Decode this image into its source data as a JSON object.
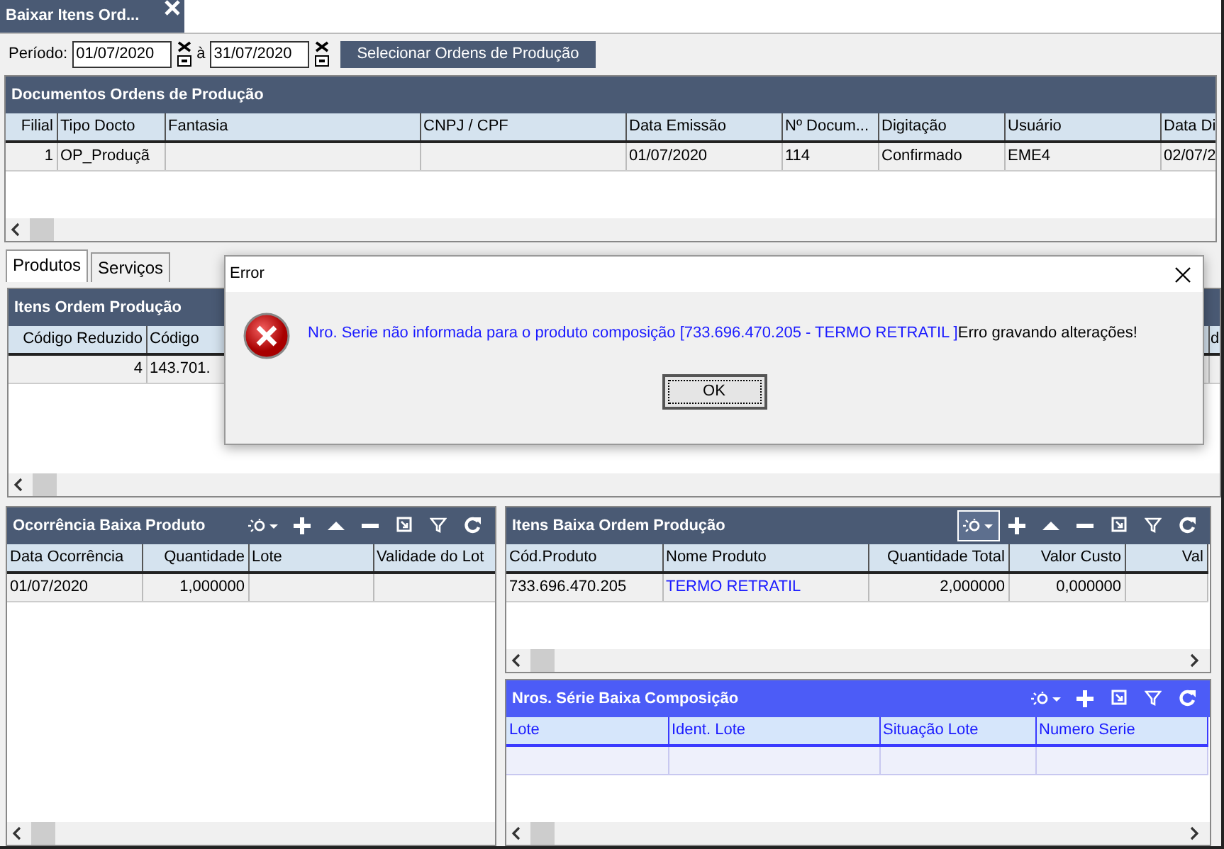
{
  "document_tab": {
    "label": "Baixar Itens Ord...",
    "selected": true
  },
  "period": {
    "label": "Período:",
    "from": "01/07/2020",
    "separator": "à",
    "to": "31/07/2020",
    "button": "Selecionar Ordens de Produção"
  },
  "documents_panel": {
    "title": "Documentos Ordens de Produção",
    "columns": [
      "Filial",
      "Tipo Docto",
      "Fantasia",
      "CNPJ / CPF",
      "Data Emissão",
      "Nº Docum...",
      "Digitação",
      "Usuário",
      "Data Di"
    ],
    "rows": [
      [
        "1",
        "OP_Produçã",
        null,
        null,
        "01/07/2020",
        "114",
        "Confirmado",
        "EME4",
        "02/07/2"
      ]
    ]
  },
  "detail_tabs": [
    {
      "label": "Produtos",
      "selected": true
    },
    {
      "label": "Serviços",
      "selected": false
    }
  ],
  "items_panel": {
    "title": "Itens Ordem Produção",
    "columns": [
      "Código Reduzido",
      "Código",
      "d"
    ],
    "rows": [
      [
        "4",
        "143.701.",
        null
      ]
    ]
  },
  "occurrence_panel": {
    "title": "Ocorrência Baixa Produto",
    "toolbar": [
      {
        "kind": "columns",
        "selected": false
      },
      {
        "kind": "add",
        "selected": false
      },
      {
        "kind": "up",
        "selected": false
      },
      {
        "kind": "remove",
        "selected": false
      },
      {
        "kind": "export",
        "selected": false
      },
      {
        "kind": "filter",
        "selected": false
      },
      {
        "kind": "refresh",
        "selected": false
      }
    ],
    "columns": [
      "Data Ocorrência",
      "Quantidade",
      "Lote",
      "Validade do Lot"
    ],
    "rows": [
      [
        "01/07/2020",
        "1,000000",
        null,
        null
      ]
    ]
  },
  "items_baixa_panel": {
    "title": "Itens Baixa Ordem Produção",
    "toolbar": [
      {
        "kind": "columns",
        "selected": true
      },
      {
        "kind": "add",
        "selected": false
      },
      {
        "kind": "up",
        "selected": false
      },
      {
        "kind": "remove",
        "selected": false
      },
      {
        "kind": "export",
        "selected": false
      },
      {
        "kind": "filter",
        "selected": false
      },
      {
        "kind": "refresh",
        "selected": false
      }
    ],
    "columns": [
      "Cód.Produto",
      "Nome Produto",
      "Quantidade Total",
      "Valor Custo",
      "Val"
    ],
    "rows": [
      [
        "733.696.470.205",
        "TERMO RETRATIL",
        "2,000000",
        "0,000000",
        null
      ]
    ]
  },
  "serial_panel": {
    "title": "Nros. Série Baixa Composição",
    "toolbar": [
      {
        "kind": "columns",
        "selected": false
      },
      {
        "kind": "add",
        "selected": false
      },
      {
        "kind": "export",
        "selected": false
      },
      {
        "kind": "filter",
        "selected": false
      },
      {
        "kind": "refresh",
        "selected": false
      }
    ],
    "columns": [
      "Lote",
      "Ident. Lote",
      "Situação Lote",
      "Numero Serie"
    ],
    "rows": [
      [
        null,
        null,
        null,
        null
      ]
    ]
  },
  "dialog": {
    "title": "Error",
    "message": "Nro. Serie não informada para o produto composição [733.696.470.205 - TERMO RETRATIL ]",
    "message_suffix": "Erro gravando alterações!",
    "button": "OK"
  }
}
